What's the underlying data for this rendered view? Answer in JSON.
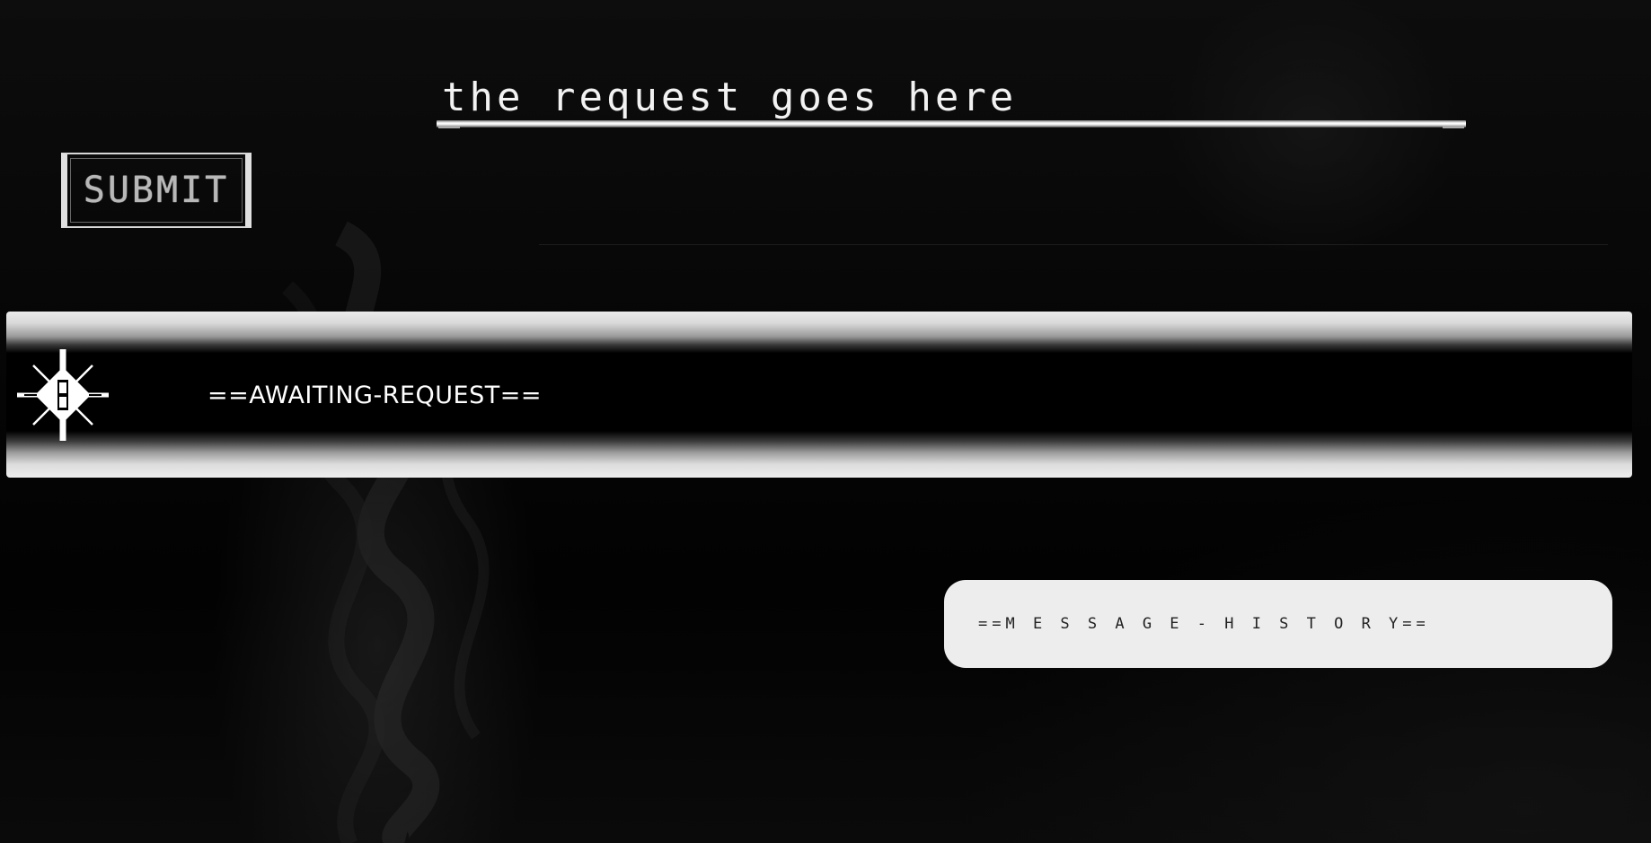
{
  "request": {
    "value": "the request goes here"
  },
  "submit": {
    "label": "SUBMIT"
  },
  "status": {
    "text": "==AWAITING-REQUEST==",
    "emblem_icon": "compass-star-icon"
  },
  "history": {
    "title": "==M E S S A G E  -  H I S T O R Y=="
  },
  "colors": {
    "background": "#050505",
    "text": "#ffffff",
    "panel": "#ededed",
    "button_text": "#b8b8b8"
  }
}
